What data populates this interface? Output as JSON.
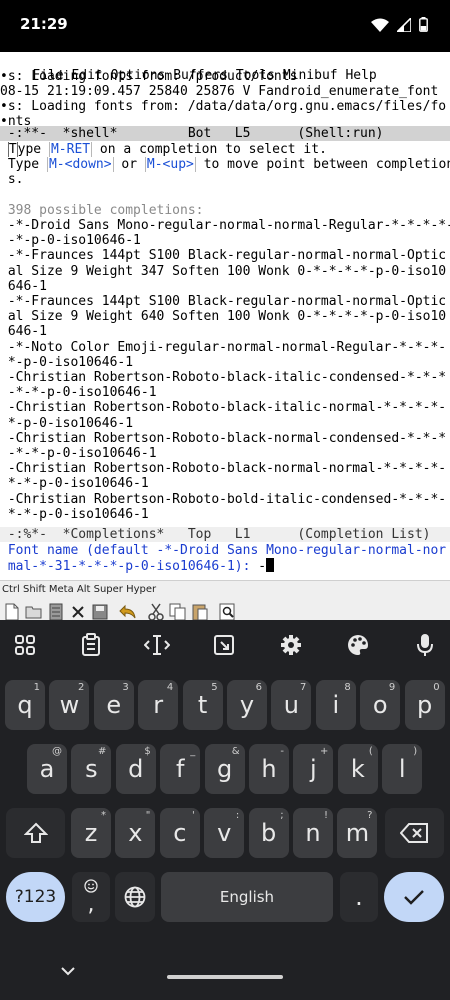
{
  "status": {
    "time": "21:29"
  },
  "menubar": [
    "File",
    "Edit",
    "Options",
    "Buffers",
    "Tools",
    "Minibuf",
    "Help"
  ],
  "log_lines": [
    "•s: Loading fonts from: /product/fonts",
    "08-15 21:19:09.457 25840 25876 V Fandroid_enumerate_font",
    "•s: Loading fonts from: /data/data/org.gnu.emacs/files/fo",
    "•nts"
  ],
  "shell_modeline": " -:**-  *shell*         Bot   L5      (Shell:run)",
  "completions_help": {
    "line1_pre": "ype ",
    "line1_first": "T",
    "line1_key": "M-RET",
    "line1_post": " on a completion to select it.",
    "line2_pre": " Type ",
    "line2_key1": "M-<down>",
    "line2_mid": " or ",
    "line2_key2": "M-<up>",
    "line2_post": " to move point between completion",
    "line3": " s."
  },
  "completions_count": " 398 possible completions:",
  "completions": [
    " -*-Droid Sans Mono-regular-normal-normal-Regular-*-*-*-*-",
    " -*-p-0-iso10646-1",
    " -*-Fraunces 144pt S100 Black-regular-normal-normal-Optic",
    " al Size 9 Weight 347 Soften 100 Wonk 0-*-*-*-*-p-0-iso10",
    " 646-1",
    " -*-Fraunces 144pt S100 Black-regular-normal-normal-Optic",
    " al Size 9 Weight 640 Soften 100 Wonk 0-*-*-*-*-p-0-iso10",
    " 646-1",
    " -*-Noto Color Emoji-regular-normal-normal-Regular-*-*-*-",
    " *-p-0-iso10646-1",
    " -Christian Robertson-Roboto-black-italic-condensed-*-*-*",
    " -*-*-p-0-iso10646-1",
    " -Christian Robertson-Roboto-black-italic-normal-*-*-*-*-",
    " *-p-0-iso10646-1",
    " -Christian Robertson-Roboto-black-normal-condensed-*-*-*",
    " -*-*-p-0-iso10646-1",
    " -Christian Robertson-Roboto-black-normal-normal-*-*-*-*-",
    " *-*-p-0-iso10646-1",
    " -Christian Robertson-Roboto-bold-italic-condensed-*-*-*-",
    " *-*-p-0-iso10646-1"
  ],
  "completion_modeline": " -:%*-  *Completions*   Top   L1      (Completion List)",
  "minibuffer": {
    "line1": " Font name (default -*-Droid Sans Mono-regular-normal-nor",
    "line2": " mal-*-31-*-*-*-p-0-iso10646-1): ",
    "input": "-"
  },
  "modifier_bar": "Ctrl Shift Meta Alt Super Hyper",
  "toolbar_icons": [
    "new-file-icon",
    "open-folder-icon",
    "dired-icon",
    "close-icon",
    "save-icon",
    "undo-icon",
    "cut-icon",
    "copy-icon",
    "paste-icon",
    "search-icon"
  ],
  "keyboard": {
    "row1": [
      {
        "k": "q",
        "h": "1"
      },
      {
        "k": "w",
        "h": "2"
      },
      {
        "k": "e",
        "h": "3"
      },
      {
        "k": "r",
        "h": "4"
      },
      {
        "k": "t",
        "h": "5"
      },
      {
        "k": "y",
        "h": "6"
      },
      {
        "k": "u",
        "h": "7"
      },
      {
        "k": "i",
        "h": "8"
      },
      {
        "k": "o",
        "h": "9"
      },
      {
        "k": "p",
        "h": "0"
      }
    ],
    "row2": [
      {
        "k": "a",
        "h": "@"
      },
      {
        "k": "s",
        "h": "#"
      },
      {
        "k": "d",
        "h": "$"
      },
      {
        "k": "f",
        "h": "_"
      },
      {
        "k": "g",
        "h": "&"
      },
      {
        "k": "h",
        "h": "-"
      },
      {
        "k": "j",
        "h": "+"
      },
      {
        "k": "k",
        "h": "("
      },
      {
        "k": "l",
        "h": ")"
      }
    ],
    "row3": [
      {
        "k": "z",
        "h": "*"
      },
      {
        "k": "x",
        "h": "\""
      },
      {
        "k": "c",
        "h": "'"
      },
      {
        "k": "v",
        "h": ":"
      },
      {
        "k": "b",
        "h": ";"
      },
      {
        "k": "n",
        "h": "!"
      },
      {
        "k": "m",
        "h": "?"
      }
    ],
    "symbols_label": "?123",
    "comma_label": ",",
    "space_label": "English",
    "period_label": "."
  },
  "colors": {
    "keyboard_bg": "#202124",
    "key_bg": "#3c3d40",
    "accent": "#c2d7f7",
    "modeline_bg": "#d2d2d2"
  }
}
